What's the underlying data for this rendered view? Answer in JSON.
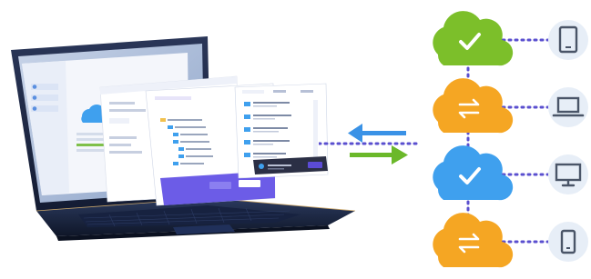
{
  "illustration": {
    "colors": {
      "green_cloud": "#7cbf2a",
      "orange_cloud": "#f5a623",
      "blue_cloud": "#3fa0ee",
      "dotted_line": "#5a4fcf",
      "device_circle": "#e7eef7",
      "device_outline": "#4a5568",
      "arrow_left": "#3a92e6",
      "arrow_right": "#6bb82a",
      "laptop_body": "#1f2a44",
      "accent_purple": "#5b4bd6"
    },
    "clouds": [
      {
        "status": "synced",
        "icon": "checkmark-icon",
        "color": "green"
      },
      {
        "status": "syncing",
        "icon": "sync-arrows-icon",
        "color": "orange"
      },
      {
        "status": "synced",
        "icon": "checkmark-icon",
        "color": "blue"
      },
      {
        "status": "syncing",
        "icon": "sync-arrows-icon",
        "color": "orange"
      }
    ],
    "devices": [
      {
        "icon": "tablet-icon"
      },
      {
        "icon": "laptop-icon"
      },
      {
        "icon": "desktop-monitor-icon"
      },
      {
        "icon": "smartphone-icon"
      }
    ],
    "transfer_arrows": [
      {
        "direction": "left",
        "color": "blue",
        "icon": "arrow-left-icon"
      },
      {
        "direction": "right",
        "color": "green",
        "icon": "arrow-right-icon"
      }
    ]
  }
}
